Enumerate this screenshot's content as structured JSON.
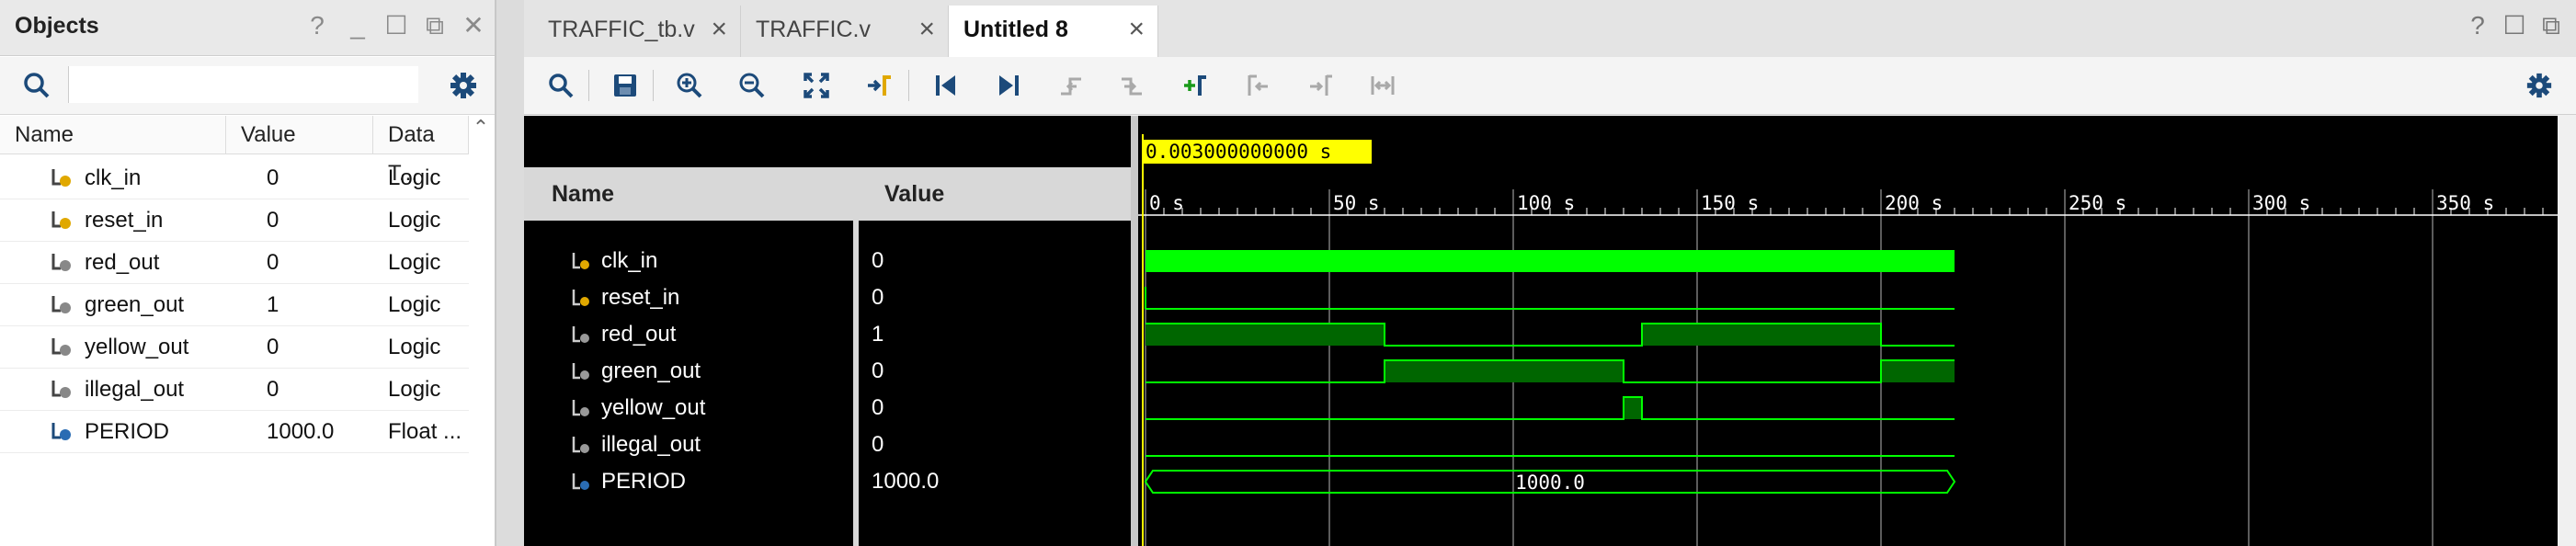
{
  "objects": {
    "title": "Objects",
    "window_controls": [
      "?",
      "_",
      "☐",
      "⧉",
      "✕"
    ],
    "columns": [
      "Name",
      "Value",
      "Data T..."
    ],
    "rows": [
      {
        "name": "clk_in",
        "value": "0",
        "type": "Logic",
        "icon": "input-signal-icon"
      },
      {
        "name": "reset_in",
        "value": "0",
        "type": "Logic",
        "icon": "input-signal-icon"
      },
      {
        "name": "red_out",
        "value": "0",
        "type": "Logic",
        "icon": "output-signal-icon"
      },
      {
        "name": "green_out",
        "value": "1",
        "type": "Logic",
        "icon": "output-signal-icon"
      },
      {
        "name": "yellow_out",
        "value": "0",
        "type": "Logic",
        "icon": "output-signal-icon"
      },
      {
        "name": "illegal_out",
        "value": "0",
        "type": "Logic",
        "icon": "output-signal-icon"
      },
      {
        "name": "PERIOD",
        "value": "1000.0",
        "type": "Float ...",
        "icon": "parameter-icon"
      }
    ]
  },
  "editor": {
    "tabs": [
      {
        "label": "TRAFFIC_tb.v",
        "active": false
      },
      {
        "label": "TRAFFIC.v",
        "active": false
      },
      {
        "label": "Untitled 8",
        "active": true
      }
    ],
    "window_controls": [
      "?",
      "☐",
      "⧉"
    ],
    "toolbar_icons": [
      "search-icon",
      "save-icon",
      "zoom-in-icon",
      "zoom-out-icon",
      "zoom-fit-icon",
      "go-to-cursor-icon",
      "go-to-time-0-icon",
      "go-to-last-time-icon",
      "previous-transition-icon",
      "next-transition-icon",
      "add-marker-icon",
      "previous-marker-icon",
      "next-marker-icon",
      "swap-cursors-icon"
    ]
  },
  "waveform": {
    "cursor_time": "0.003000000000 s",
    "columns": [
      "Name",
      "Value"
    ],
    "signals": [
      {
        "name": "clk_in",
        "value": "0"
      },
      {
        "name": "reset_in",
        "value": "0"
      },
      {
        "name": "red_out",
        "value": "1"
      },
      {
        "name": "green_out",
        "value": "0"
      },
      {
        "name": "yellow_out",
        "value": "0"
      },
      {
        "name": "illegal_out",
        "value": "0"
      },
      {
        "name": "PERIOD",
        "value": "1000.0"
      }
    ],
    "time_ticks": [
      "0 s",
      "50 s",
      "100 s",
      "150 s",
      "200 s",
      "250 s",
      "300 s",
      "350 s"
    ],
    "time_tick_values": [
      0,
      50,
      100,
      150,
      200,
      250,
      300,
      350
    ],
    "sim_end": 220,
    "traces": {
      "red_out": [
        [
          0,
          1
        ],
        [
          65,
          0
        ],
        [
          135,
          1
        ],
        [
          200,
          0
        ],
        [
          220,
          0
        ]
      ],
      "green_out": [
        [
          0,
          0
        ],
        [
          65,
          1
        ],
        [
          130,
          0
        ],
        [
          200,
          1
        ],
        [
          220,
          1
        ]
      ],
      "yellow_out": [
        [
          0,
          0
        ],
        [
          130,
          1
        ],
        [
          135,
          0
        ],
        [
          220,
          0
        ]
      ]
    },
    "period_bus_label": "1000.0",
    "colors": {
      "trace": "#00ff00",
      "fill": "#006600",
      "cursor": "#ffff00",
      "grid": "#7a7a7a",
      "background": "#000000"
    }
  }
}
